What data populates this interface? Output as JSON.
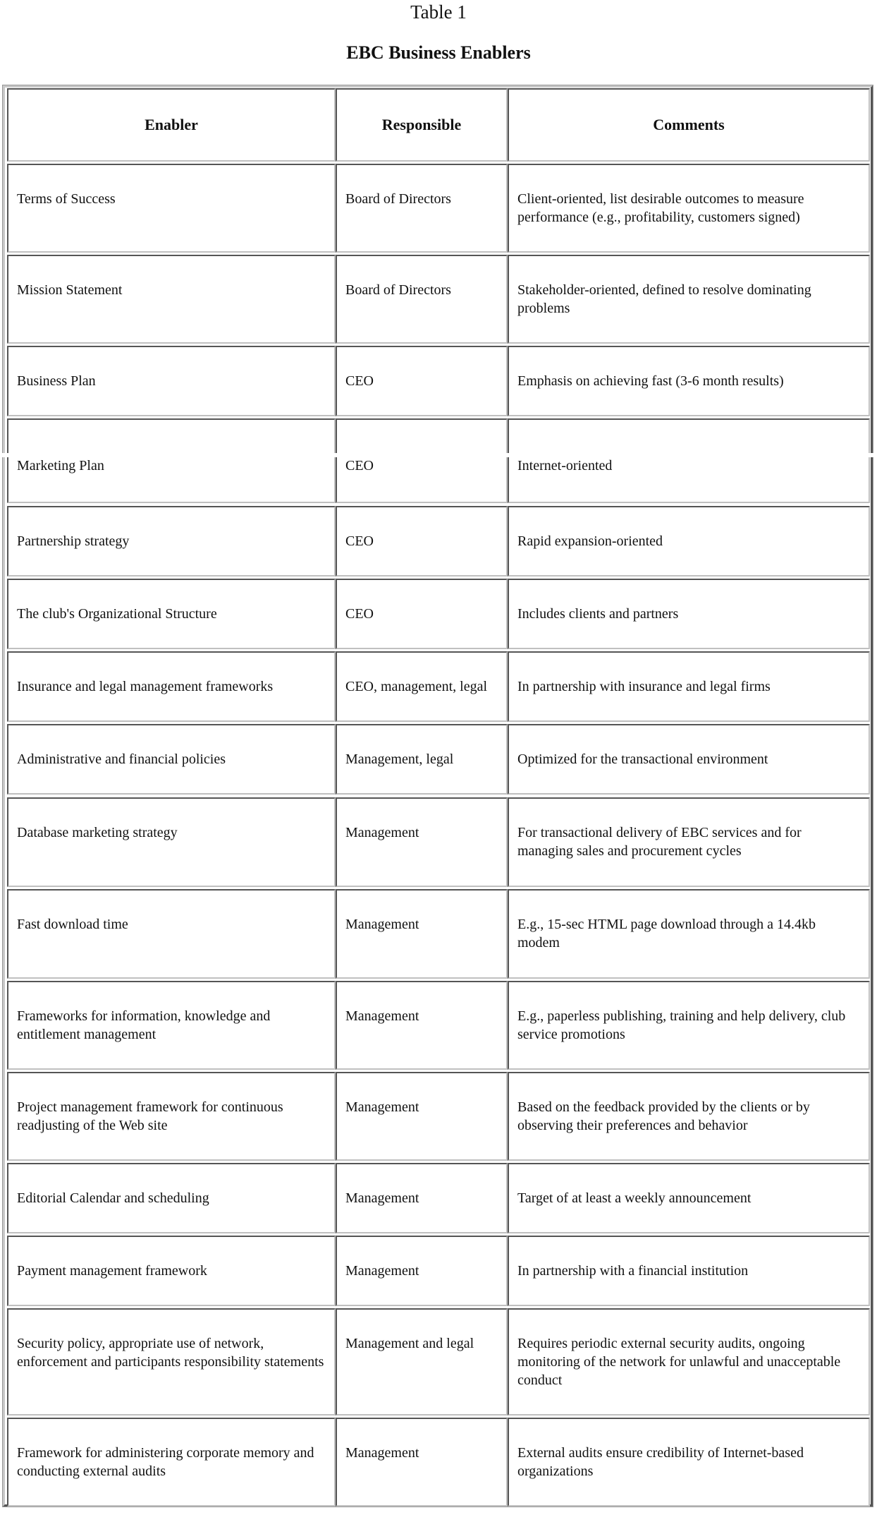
{
  "caption": {
    "table_number": "Table 1",
    "title": "EBC Business Enablers"
  },
  "table": {
    "headers": [
      "Enabler",
      "Responsible",
      "Comments"
    ],
    "rows": [
      {
        "enabler": "Terms of Success",
        "responsible": "Board of Directors",
        "comments": "Client-oriented, list desirable outcomes to measure performance (e.g., profitability, customers signed)"
      },
      {
        "enabler": "Mission Statement",
        "responsible": "Board of Directors",
        "comments": "Stakeholder-oriented, defined to resolve dominating problems"
      },
      {
        "enabler": "Business Plan",
        "responsible": "CEO",
        "comments": "Emphasis on achieving fast (3-6 month results)"
      },
      {
        "enabler": "Marketing Plan",
        "responsible": "CEO",
        "comments": "Internet-oriented"
      },
      {
        "enabler": "Partnership strategy",
        "responsible": "CEO",
        "comments": "Rapid expansion-oriented"
      },
      {
        "enabler": "The club's Organizational Structure",
        "responsible": "CEO",
        "comments": "Includes clients and partners"
      },
      {
        "enabler": "Insurance and legal management frameworks",
        "responsible": "CEO, management, legal",
        "comments": "In partnership with insurance and legal firms"
      },
      {
        "enabler": "Administrative and financial policies",
        "responsible": "Management, legal",
        "comments": "Optimized for the transactional environment"
      },
      {
        "enabler": "Database marketing strategy",
        "responsible": "Management",
        "comments": "For transactional delivery of EBC services and for managing sales and procurement cycles"
      },
      {
        "enabler": "Fast download time",
        "responsible": "Management",
        "comments": "E.g., 15-sec HTML page download through a 14.4kb modem"
      },
      {
        "enabler": "Frameworks for information, knowledge and entitlement management",
        "responsible": "Management",
        "comments": "E.g., paperless publishing, training and help delivery, club service promotions"
      },
      {
        "enabler": "Project management framework for continuous readjusting of the Web site",
        "responsible": "Management",
        "comments": "Based on the feedback provided by the clients or by observing their preferences and behavior"
      },
      {
        "enabler": "Editorial Calendar and scheduling",
        "responsible": "Management",
        "comments": "Target of at least a weekly announcement"
      },
      {
        "enabler": "Payment management framework",
        "responsible": "Management",
        "comments": "In partnership with a financial institution"
      },
      {
        "enabler": "Security policy, appropriate use of network, enforcement and participants responsibility statements",
        "responsible": "Management and legal",
        "comments": "Requires periodic external security audits, ongoing monitoring of the network for unlawful and unacceptable conduct"
      },
      {
        "enabler": "Framework for administering corporate memory and conducting external audits",
        "responsible": "Management",
        "comments": "External audits ensure credibility of Internet-based organizations"
      }
    ]
  }
}
